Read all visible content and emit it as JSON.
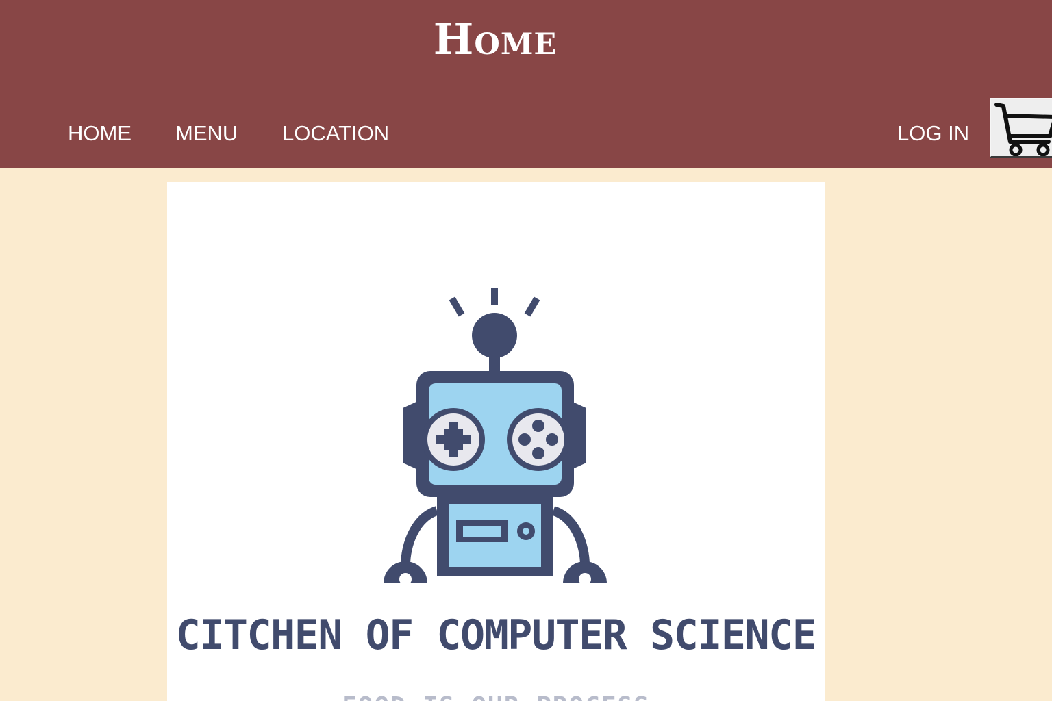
{
  "header": {
    "title": "Home",
    "background_color": "#884646"
  },
  "nav": {
    "home_label": "HOME",
    "menu_label": "MENU",
    "location_label": "LOCATION",
    "login_label": "LOG IN",
    "cart_icon": "shopping-cart-icon"
  },
  "logo": {
    "icon": "robot-icon",
    "name": "CITCHEN OF COMPUTER SCIENCE",
    "tagline": "FOOD IS OUR PROCESS",
    "primary_color": "#414b6d",
    "accent_color": "#9dd4f0"
  },
  "page": {
    "background_color": "#fbebcf"
  }
}
